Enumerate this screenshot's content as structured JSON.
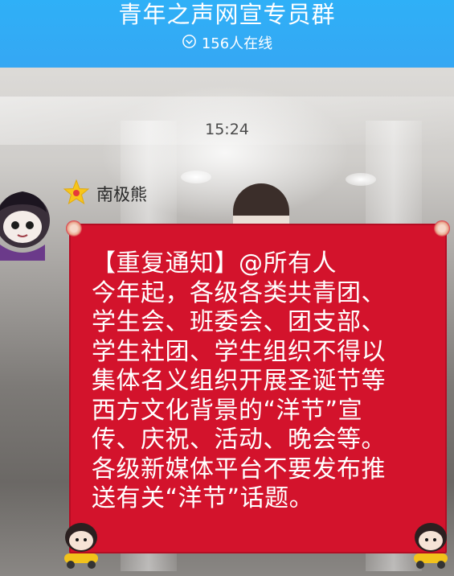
{
  "header": {
    "title": "青年之声网宣专员群",
    "online": "156人在线"
  },
  "chat": {
    "timestamp": "15:24",
    "sender": "南极熊",
    "message": "【重复通知】@所有人\n今年起，各级各类共青团、\n学生会、班委会、团支部、\n学生社团、学生组织不得以\n集体名义组织开展圣诞节等\n西方文化背景的“洋节”宣\n传、庆祝、活动、晚会等。\n各级新媒体平台不要发布推\n送有关“洋节”话题。"
  },
  "colors": {
    "header": "#2fb0f7",
    "bubble": "#d3132c"
  },
  "icons": [
    "chevron-down-circle-icon",
    "star-badge-icon",
    "avatar",
    "cartoon-sticker"
  ]
}
